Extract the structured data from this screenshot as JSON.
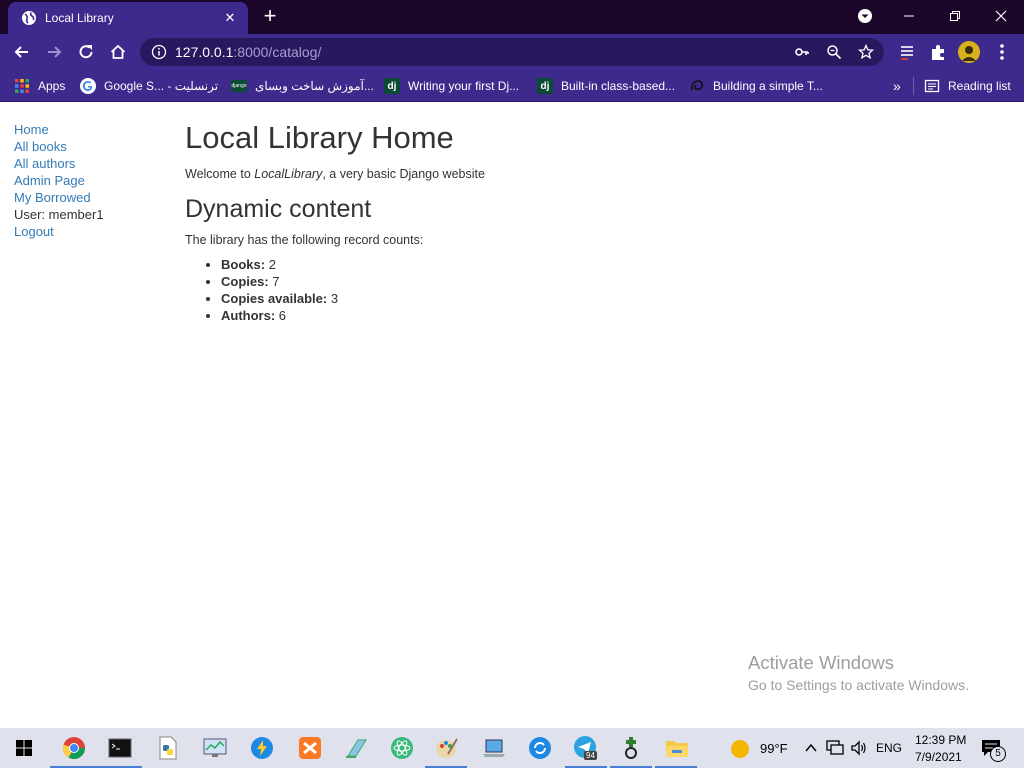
{
  "browser": {
    "tab": {
      "title": "Local Library",
      "close": "✕"
    },
    "new_tab": "+",
    "url_host": "127.0.0.1",
    "url_rest": ":8000/catalog/"
  },
  "bookmarks": [
    {
      "label": "Apps",
      "icon": "apps-grid-icon"
    },
    {
      "label": "Google S... - ترنسلیت",
      "icon": "google-icon"
    },
    {
      "label": "آموزش ساخت وبسای...",
      "icon": "django-icon"
    },
    {
      "label": "Writing your first Dj...",
      "icon": "dj-icon"
    },
    {
      "label": "Built-in class-based...",
      "icon": "dj-icon"
    },
    {
      "label": "Building a simple T...",
      "icon": "swirl-icon"
    }
  ],
  "bookmarks_more": "»",
  "reading_list": "Reading list",
  "django_icon_text": "django",
  "dj_icon_text": "dj",
  "sidebar": {
    "links": [
      "Home",
      "All books",
      "All authors",
      "Admin Page",
      "My Borrowed"
    ],
    "user": "User: member1",
    "logout": "Logout"
  },
  "main": {
    "title": "Local Library Home",
    "welcome_pre": "Welcome to ",
    "welcome_em": "LocalLibrary",
    "welcome_post": ", a very basic Django website",
    "dynamic_heading": "Dynamic content",
    "records_intro": "The library has the following record counts:",
    "counts": [
      {
        "label": "Books:",
        "value": "2"
      },
      {
        "label": "Copies:",
        "value": "7"
      },
      {
        "label": "Copies available:",
        "value": "3"
      },
      {
        "label": "Authors:",
        "value": "6"
      }
    ]
  },
  "watermark": {
    "line1": "Activate Windows",
    "line2": "Go to Settings to activate Windows."
  },
  "taskbar": {
    "weather": "99°F",
    "language": "ENG",
    "time": "12:39 PM",
    "date": "7/9/2021",
    "notifications": "5",
    "telegram_badge": "94"
  },
  "colors": {
    "tab_strip": "#1b0629",
    "toolbar": "#3d2a8c",
    "link": "#337ab7",
    "text": "#333333"
  }
}
